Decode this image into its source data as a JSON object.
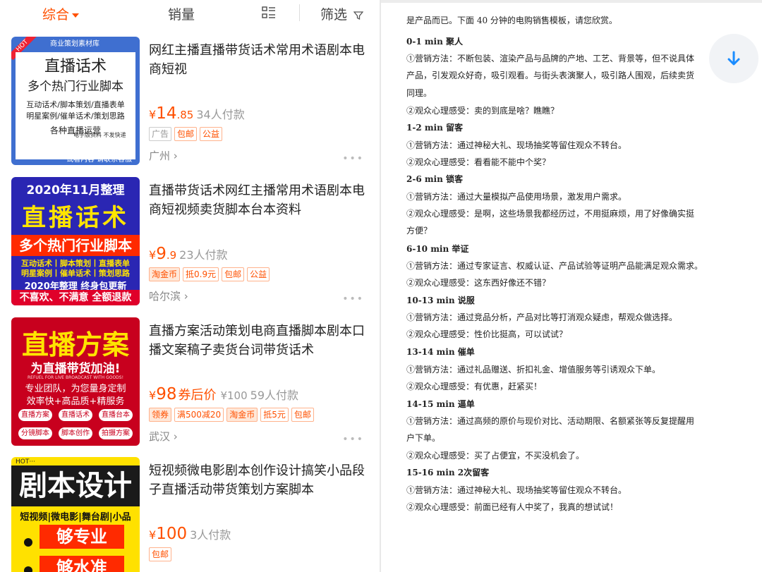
{
  "filter_bar": {
    "comprehensive": "综合",
    "sales": "销量",
    "filter": "筛选"
  },
  "products": [
    {
      "title": "网红主播直播带货话术常用术语剧本电商短视",
      "price_int": "14",
      "price_dec": ".85",
      "paid": "34人付款",
      "tags": [
        "广告",
        "包邮",
        "公益"
      ],
      "location": "广州",
      "thumb": {
        "header": "商业策划素材库",
        "hot": "HOT",
        "line1": "直播话术",
        "line2": "多个热门行业脚本",
        "line3": "互动话术/脚本策划/直播表单",
        "line4": "明星案例/催单话术/策划思路",
        "line5": "各种直播运营",
        "bottom1": "电子版资料 不发快递",
        "bottom2": "试看内容 请联系客服"
      }
    },
    {
      "title": "直播带货话术网红主播常用术语剧本电商短视频卖货脚本台本资料",
      "price_int": "9",
      "price_dec": ".9",
      "paid": "23人付款",
      "tags": [
        "淘金币",
        "抵0.9元",
        "包邮",
        "公益"
      ],
      "location": "哈尔滨",
      "thumb": {
        "line1": "2020年11月整理",
        "line2": "直播话术",
        "line3": "多个热门行业脚本",
        "line4": "互动话术丨脚本策划丨直播表单",
        "line5": "明星案例丨催单话术丨策划思路",
        "line6": "2020年整理 终身包更新",
        "line7": "不喜欢、不满意 全额退款"
      }
    },
    {
      "title": "直播方案活动策划电商直播脚本剧本口播文案稿子卖货台词带货话术",
      "price_int": "98",
      "coupon": "券后价",
      "original": "¥100",
      "paid": "59人付款",
      "tags": [
        "领券",
        "满500减20",
        "淘金币",
        "抵5元",
        "包邮"
      ],
      "location": "武汉",
      "thumb": {
        "line1": "直播方案",
        "line2": "为直播带货加油!",
        "line3": "REFUEL FOR LIVE BROADCAST WITH GOODS!",
        "line4": "专业团队，为您量身定制",
        "line5": "效率快+高品质+精服务",
        "pills": [
          "直播方案",
          "直播话术",
          "直播台本",
          "分镜脚本",
          "脚本创作",
          "拍摄方案"
        ]
      }
    },
    {
      "title": "短视频微电影剧本创作设计搞笑小品段子直播活动带货策划方案脚本",
      "price_int": "100",
      "paid": "3人付款",
      "tags": [
        "包邮"
      ],
      "thumb": {
        "hot": "HOT···",
        "line1": "剧本设计",
        "line2": "短视频|微电影|舞台剧|小品",
        "line3": "够专业",
        "line4": "够水准"
      }
    }
  ],
  "document": {
    "intro": "是产品而已。下面 40 分钟的电购销售模板，请您欣赏。",
    "lines": [
      {
        "type": "head",
        "text": "0-1 min 聚人"
      },
      {
        "type": "body",
        "text": "①营销方法：不断包装、渲染产品与品牌的产地、工艺、背景等，但不说具体"
      },
      {
        "type": "body",
        "text": "产品，引发观众好奇，吸引观看。与街头表演聚人，吸引路人围观，后续卖货"
      },
      {
        "type": "body",
        "text": "同理。"
      },
      {
        "type": "body",
        "text": "②观众心理感受：卖的到底是啥？瞧瞧？"
      },
      {
        "type": "head",
        "text": "1-2 min  留客"
      },
      {
        "type": "body",
        "text": "①营销方法：通过神秘大礼、现场抽奖等留住观众不转台。"
      },
      {
        "type": "body",
        "text": "②观众心理感受：看看能不能中个奖？"
      },
      {
        "type": "head",
        "text": "2-6 min 锁客"
      },
      {
        "type": "body",
        "text": "①营销方法：通过大量模拟产品使用场景，激发用户需求。"
      },
      {
        "type": "body",
        "text": "②观众心理感受：是啊，这些场景我都经历过，不用挺麻烦，用了好像确实挺"
      },
      {
        "type": "body",
        "text": "方便？"
      },
      {
        "type": "head",
        "text": "6-10 min 举证"
      },
      {
        "type": "body",
        "text": "①营销方法：通过专家证言、权威认证、产品试验等证明产品能满足观众需求。"
      },
      {
        "type": "body",
        "text": "②观众心理感受：这东西好像还不错？"
      },
      {
        "type": "head",
        "text": "10-13 min 说服"
      },
      {
        "type": "body",
        "text": "①营销方法：通过竞品分析，产品对比等打消观众疑虑，帮观众做选择。"
      },
      {
        "type": "body",
        "text": "②观众心理感受：性价比挺高，可以试试？"
      },
      {
        "type": "head",
        "text": "13-14 min 催单"
      },
      {
        "type": "body",
        "text": "①营销方法：通过礼品赠送、折扣礼金、增值服务等引诱观众下单。"
      },
      {
        "type": "body",
        "text": "②观众心理感受：有优惠，赶紧买！"
      },
      {
        "type": "head",
        "text": "14-15 min 逼单"
      },
      {
        "type": "body",
        "text": "①营销方法：通过高频的原价与现价对比、活动期限、名额紧张等反复提醒用"
      },
      {
        "type": "body",
        "text": "户下单。"
      },
      {
        "type": "body",
        "text": "②观众心理感受：买了占便宜，不买没机会了。"
      },
      {
        "type": "head",
        "text": "15-16 min 2次留客"
      },
      {
        "type": "body",
        "text": "①营销方法：通过神秘大礼、现场抽奖等留住观众不转台。"
      },
      {
        "type": "body",
        "text": "②观众心理感受：前面已经有人中奖了，我真的想试试！"
      }
    ]
  },
  "download_icon": "arrow-down-icon",
  "colors": {
    "accent": "#ff5000",
    "link": "#1a8cff"
  }
}
